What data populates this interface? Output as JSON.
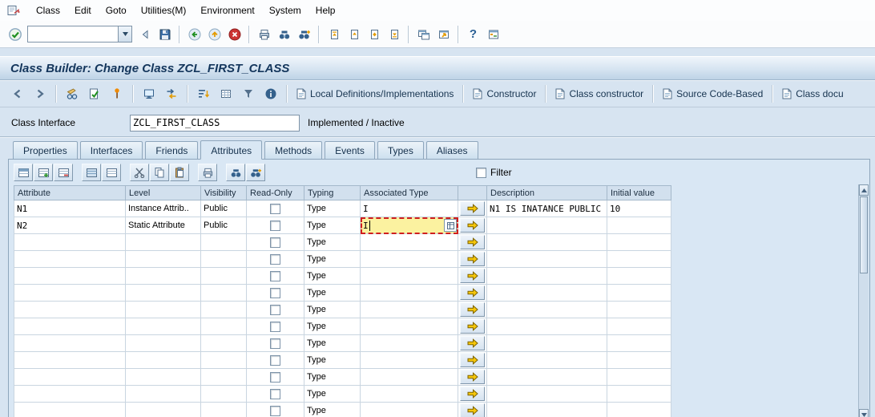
{
  "menubar": {
    "items": [
      {
        "label": "Class"
      },
      {
        "label": "Edit"
      },
      {
        "label": "Goto"
      },
      {
        "label": "Utilities(M)"
      },
      {
        "label": "Environment"
      },
      {
        "label": "System"
      },
      {
        "label": "Help"
      }
    ]
  },
  "system_toolbar": {
    "command_field_value": ""
  },
  "titlebar": {
    "title": "Class Builder: Change Class ZCL_FIRST_CLASS"
  },
  "app_toolbar": {
    "text_buttons": [
      {
        "label": "Local Definitions/Implementations",
        "icon": "document"
      },
      {
        "label": "Constructor",
        "icon": "document"
      },
      {
        "label": "Class constructor",
        "icon": "document"
      },
      {
        "label": "Source Code-Based",
        "icon": "grid"
      },
      {
        "label": "Class docu",
        "icon": "document"
      }
    ]
  },
  "class_header": {
    "label": "Class Interface",
    "value": "ZCL_FIRST_CLASS",
    "status": "Implemented / Inactive"
  },
  "tabs": {
    "items": [
      {
        "label": "Properties",
        "active": false
      },
      {
        "label": "Interfaces",
        "active": false
      },
      {
        "label": "Friends",
        "active": false
      },
      {
        "label": "Attributes",
        "active": true
      },
      {
        "label": "Methods",
        "active": false
      },
      {
        "label": "Events",
        "active": false
      },
      {
        "label": "Types",
        "active": false
      },
      {
        "label": "Aliases",
        "active": false
      }
    ]
  },
  "attributes_tab": {
    "filter_label": "Filter",
    "filter_checked": false
  },
  "icons": {
    "help_glyph": "?"
  },
  "table": {
    "columns": [
      "Attribute",
      "Level",
      "Visibility",
      "Read-Only",
      "Typing",
      "Associated Type",
      "",
      "Description",
      "Initial value"
    ],
    "rows": [
      {
        "attribute": "N1",
        "level": "Instance Attrib..",
        "visibility": "Public",
        "read_only": false,
        "typing": "Type",
        "associated_type": "I",
        "description": "N1 IS INATANCE PUBLIC",
        "initial_value": "10",
        "editing": false
      },
      {
        "attribute": "N2",
        "level": "Static Attribute",
        "visibility": "Public",
        "read_only": false,
        "typing": "Type",
        "associated_type": "I",
        "description": "",
        "initial_value": "",
        "editing": true
      },
      {
        "attribute": "",
        "level": "",
        "visibility": "",
        "read_only": false,
        "typing": "Type",
        "associated_type": "",
        "description": "",
        "initial_value": "",
        "editing": false
      },
      {
        "attribute": "",
        "level": "",
        "visibility": "",
        "read_only": false,
        "typing": "Type",
        "associated_type": "",
        "description": "",
        "initial_value": "",
        "editing": false
      },
      {
        "attribute": "",
        "level": "",
        "visibility": "",
        "read_only": false,
        "typing": "Type",
        "associated_type": "",
        "description": "",
        "initial_value": "",
        "editing": false
      },
      {
        "attribute": "",
        "level": "",
        "visibility": "",
        "read_only": false,
        "typing": "Type",
        "associated_type": "",
        "description": "",
        "initial_value": "",
        "editing": false
      },
      {
        "attribute": "",
        "level": "",
        "visibility": "",
        "read_only": false,
        "typing": "Type",
        "associated_type": "",
        "description": "",
        "initial_value": "",
        "editing": false
      },
      {
        "attribute": "",
        "level": "",
        "visibility": "",
        "read_only": false,
        "typing": "Type",
        "associated_type": "",
        "description": "",
        "initial_value": "",
        "editing": false
      },
      {
        "attribute": "",
        "level": "",
        "visibility": "",
        "read_only": false,
        "typing": "Type",
        "associated_type": "",
        "description": "",
        "initial_value": "",
        "editing": false
      },
      {
        "attribute": "",
        "level": "",
        "visibility": "",
        "read_only": false,
        "typing": "Type",
        "associated_type": "",
        "description": "",
        "initial_value": "",
        "editing": false
      },
      {
        "attribute": "",
        "level": "",
        "visibility": "",
        "read_only": false,
        "typing": "Type",
        "associated_type": "",
        "description": "",
        "initial_value": "",
        "editing": false
      },
      {
        "attribute": "",
        "level": "",
        "visibility": "",
        "read_only": false,
        "typing": "Type",
        "associated_type": "",
        "description": "",
        "initial_value": "",
        "editing": false
      },
      {
        "attribute": "",
        "level": "",
        "visibility": "",
        "read_only": false,
        "typing": "Type",
        "associated_type": "",
        "description": "",
        "initial_value": "",
        "editing": false
      }
    ]
  }
}
